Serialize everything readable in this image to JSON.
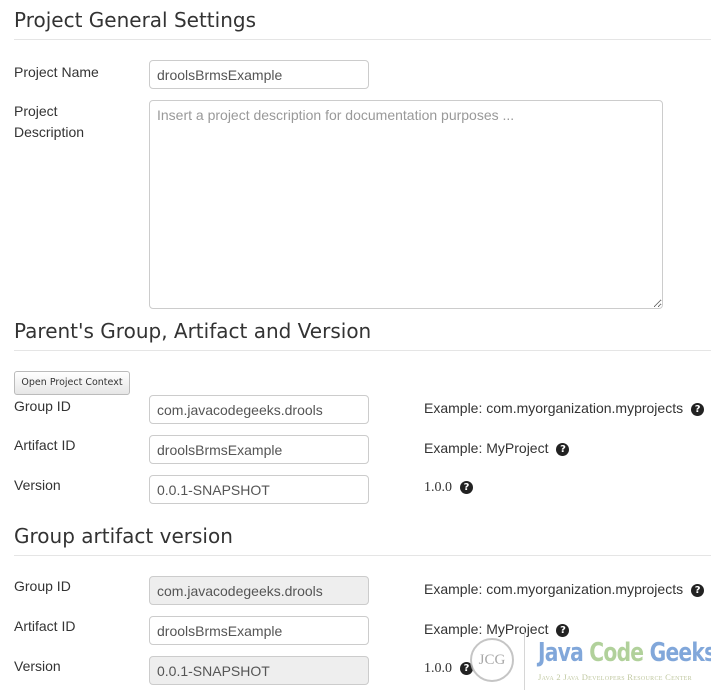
{
  "sections": {
    "general": {
      "title": "Project General Settings",
      "project_name_label": "Project Name",
      "project_name_value": "droolsBrmsExample",
      "project_description_label_line1": "Project",
      "project_description_label_line2": "Description",
      "project_description_placeholder": "Insert a project description for documentation purposes ...",
      "project_description_value": ""
    },
    "parent_gav": {
      "title": "Parent's Group, Artifact and Version",
      "open_context_button": "Open Project Context",
      "group_id_label": "Group ID",
      "group_id_value": "com.javacodegeeks.drools",
      "group_id_help": "Example: com.myorganization.myprojects",
      "artifact_id_label": "Artifact ID",
      "artifact_id_value": "droolsBrmsExample",
      "artifact_id_help": "Example: MyProject",
      "version_label": "Version",
      "version_value": "0.0.1-SNAPSHOT",
      "version_help": "1.0.0"
    },
    "gav": {
      "title": "Group artifact version",
      "group_id_label": "Group ID",
      "group_id_value": "com.javacodegeeks.drools",
      "group_id_readonly": true,
      "group_id_help": "Example: com.myorganization.myprojects",
      "artifact_id_label": "Artifact ID",
      "artifact_id_value": "droolsBrmsExample",
      "artifact_id_help": "Example: MyProject",
      "version_label": "Version",
      "version_value": "0.0.1-SNAPSHOT",
      "version_readonly": true,
      "version_help": "1.0.0"
    }
  },
  "icons": {
    "help": "question-circle-icon",
    "help_glyph": "?"
  },
  "watermark": {
    "logo_text": "JCG",
    "title_part1": "Java",
    "title_part2": "Code",
    "title_part3": "Geeks",
    "tagline": "Java 2 Java Developers Resource Center"
  }
}
